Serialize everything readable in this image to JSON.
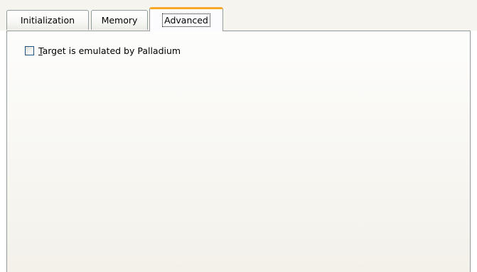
{
  "tabs": [
    {
      "label": "Initialization",
      "selected": false
    },
    {
      "label": "Memory",
      "selected": false
    },
    {
      "label": "Advanced",
      "selected": true
    }
  ],
  "advanced": {
    "checkbox": {
      "mnemonic": "T",
      "label_rest": "arget is emulated by Palladium",
      "checked": false
    }
  },
  "colors": {
    "tab_highlight": "#f6a928",
    "border": "#919b9c",
    "checkbox_border": "#1c5180"
  }
}
